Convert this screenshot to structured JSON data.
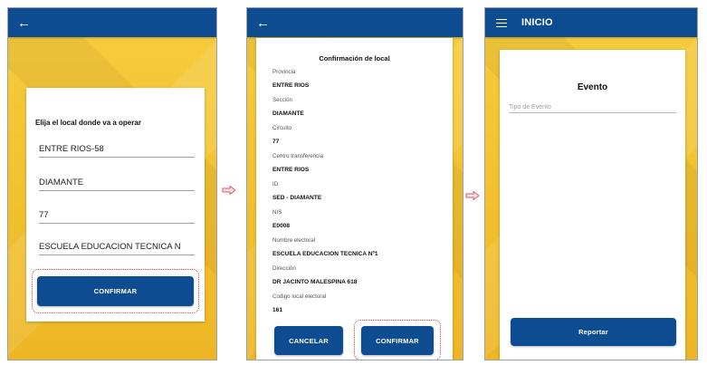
{
  "colors": {
    "appbar": "#0d4c91",
    "background": "#f2c230",
    "button": "#0d4c91",
    "highlight": "#e0403a",
    "arrow": "#e25a6e"
  },
  "screen1": {
    "back_icon": "arrow-left-icon",
    "heading": "Elija el local donde va a operar",
    "fields": [
      "ENTRE RIOS-58",
      "DIAMANTE",
      "77",
      "ESCUELA EDUCACION TECNICA N"
    ],
    "confirm_label": "CONFIRMAR"
  },
  "screen2": {
    "back_icon": "arrow-left-icon",
    "title": "Confirmación de local",
    "rows": [
      {
        "label": "Provincia",
        "value": "ENTRE RIOS"
      },
      {
        "label": "Sección",
        "value": "DIAMANTE"
      },
      {
        "label": "Circuito",
        "value": "77"
      },
      {
        "label": "Centro transferencia",
        "value": "ENTRE RIOS"
      },
      {
        "label": "ID",
        "value": "SED - DIAMANTE"
      },
      {
        "label": "NIS",
        "value": "E0008"
      },
      {
        "label": "Nombre electoral",
        "value": "ESCUELA EDUCACION TECNICA Nº1"
      },
      {
        "label": "Dirección",
        "value": "DR JACINTO MALESPINA 618"
      },
      {
        "label": "Codigo local electoral",
        "value": "161"
      }
    ],
    "cancel_label": "CANCELAR",
    "confirm_label": "CONFIRMAR"
  },
  "screen3": {
    "menu_icon": "hamburger-menu-icon",
    "title": "INICIO",
    "card_title": "Evento",
    "event_type_placeholder": "Tipo de Evento",
    "report_label": "Reportar"
  }
}
